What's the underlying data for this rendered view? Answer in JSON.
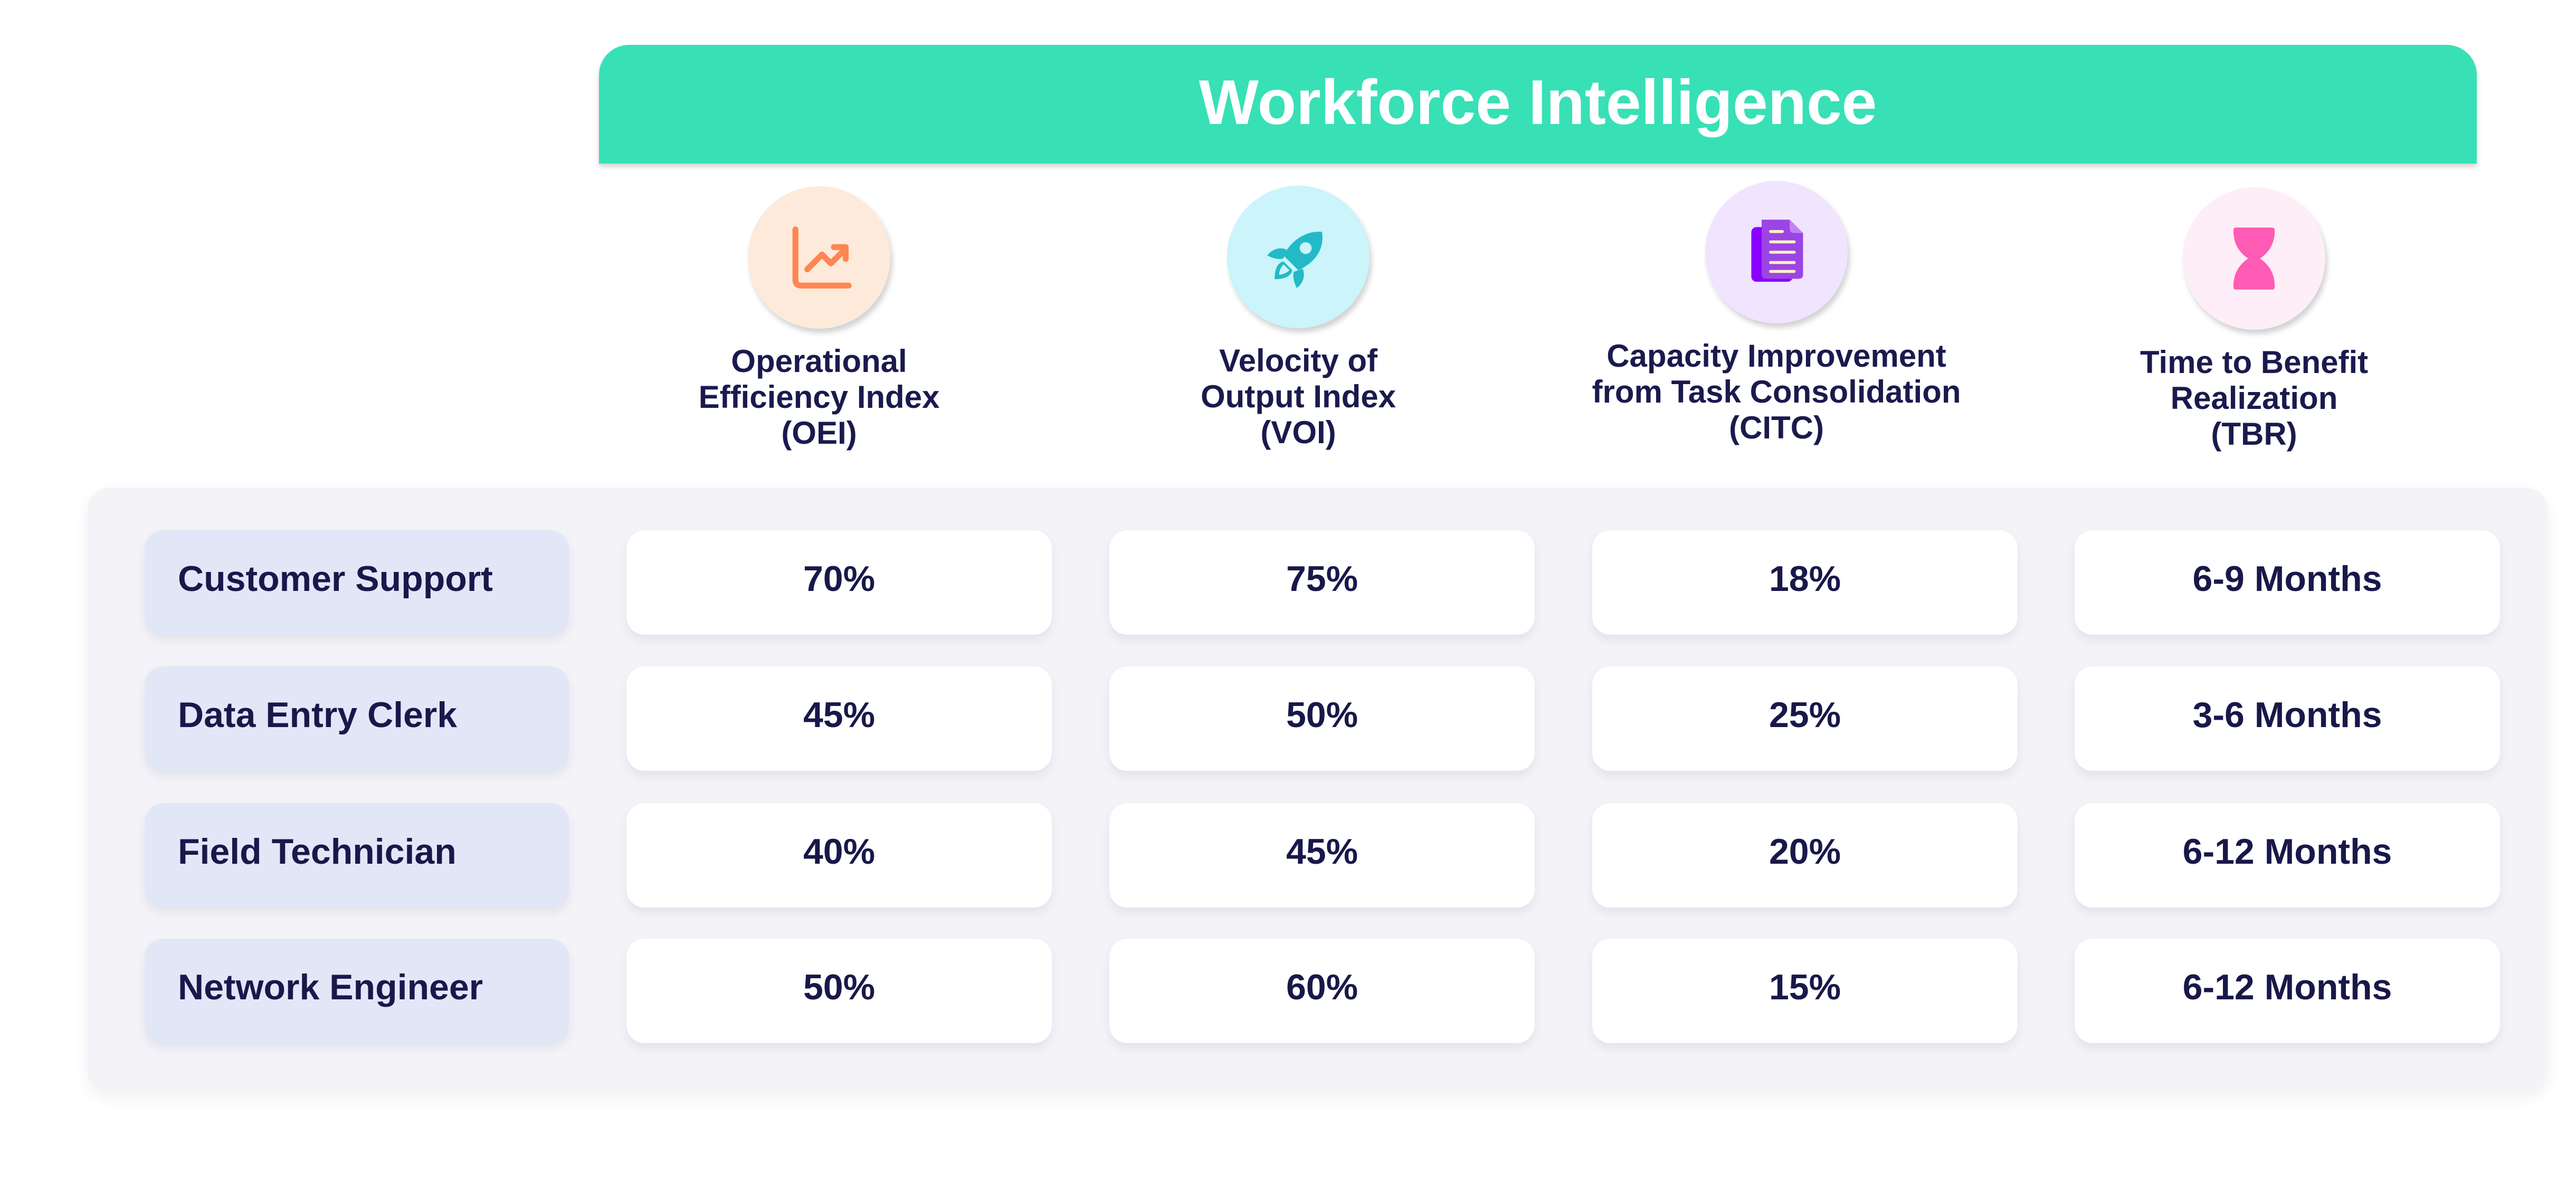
{
  "header": {
    "title": "Workforce Intelligence",
    "accent_color": "#38e0b6"
  },
  "columns": [
    {
      "label": "Operational\nEfficiency Index\n(OEI)",
      "icon": "trending-up-chart-icon",
      "icon_color": "#ff8552",
      "icon_bg": "#fdeada"
    },
    {
      "label": "Velocity of\nOutput Index\n(VOI)",
      "icon": "rocket-icon",
      "icon_color": "#22bac7",
      "icon_bg": "#cbf4fb"
    },
    {
      "label": "Capacity Improvement\nfrom Task Consolidation\n(CITC)",
      "icon": "document-icon",
      "icon_color": "#9b45e4",
      "icon_bg": "#f1e4fe"
    },
    {
      "label": "Time to Benefit\nRealization\n(TBR)",
      "icon": "hourglass-icon",
      "icon_color": "#ff5bb4",
      "icon_bg": "#feeef8"
    }
  ],
  "rows": [
    {
      "label": "Customer Support",
      "values": [
        "70%",
        "75%",
        "18%",
        "6-9 Months"
      ]
    },
    {
      "label": "Data Entry Clerk",
      "values": [
        "45%",
        "50%",
        "25%",
        "3-6 Months"
      ]
    },
    {
      "label": "Field Technician",
      "values": [
        "40%",
        "45%",
        "20%",
        "6-12 Months"
      ]
    },
    {
      "label": "Network Engineer",
      "values": [
        "50%",
        "60%",
        "15%",
        "6-12 Months"
      ]
    }
  ]
}
